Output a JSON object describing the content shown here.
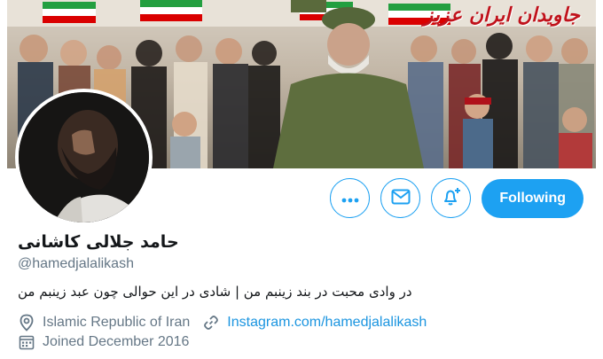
{
  "banner": {
    "caption": "جاویدان ایران عزیز"
  },
  "actions": {
    "more_icon": "more-dots-icon",
    "message_icon": "mail-icon",
    "notify_icon": "bell-plus-icon",
    "following_label": "Following"
  },
  "profile": {
    "display_name": "حامد جلالی کاشانی",
    "handle": "@hamedjalalikash",
    "bio": "در وادی محبت در بند زینبم من | شادی در این حوالی چون عبد زینبم من",
    "location": "Islamic Republic of Iran",
    "website": "Instagram.com/hamedjalalikash",
    "joined": "Joined December 2016"
  },
  "colors": {
    "accent": "#1da1f2",
    "link": "#1b95e0",
    "secondary_text": "#657786"
  }
}
